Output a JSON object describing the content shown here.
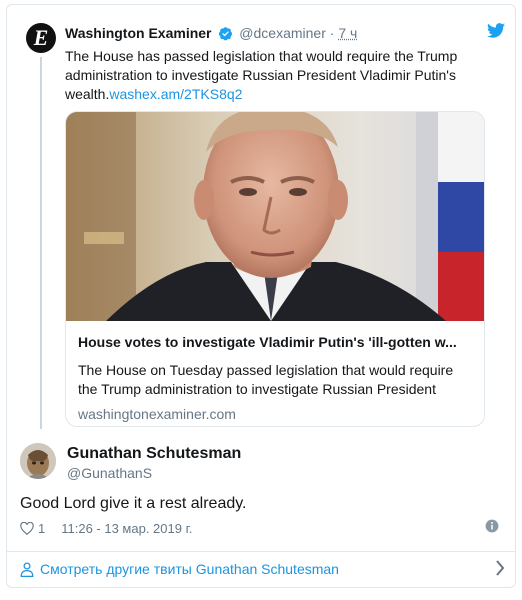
{
  "quoted_tweet": {
    "avatar_letter": "E",
    "author_name": "Washington Examiner",
    "handle": "@dcexaminer",
    "separator": "·",
    "time": "7 ч",
    "text": "The House has passed legislation that would require the Trump administration to investigate Russian President Vladimir Putin's wealth.",
    "link": "washex.am/2TKS8q2",
    "card": {
      "title": "House votes to investigate Vladimir Putin's 'ill-gotten w...",
      "description": "The House on Tuesday passed legislation that would require the Trump administration to investigate Russian President",
      "domain": "washingtonexaminer.com"
    }
  },
  "reply": {
    "author_name": "Gunathan Schutesman",
    "handle": "@GunathanS",
    "text": "Good Lord give it a rest already.",
    "likes": "1",
    "timestamp": "11:26 - 13 мар. 2019 г."
  },
  "footer": {
    "more_tweets_label": "Смотреть другие твиты Gunathan Schutesman"
  },
  "colors": {
    "link_blue": "#1b95e0",
    "secondary_gray": "#657786",
    "border": "#e1e8ed",
    "verified_blue": "#1da1f2"
  },
  "icons": [
    "washington-examiner-logo",
    "verified-badge-icon",
    "twitter-bird-icon",
    "heart-icon",
    "info-icon",
    "person-icon",
    "chevron-right-icon"
  ]
}
